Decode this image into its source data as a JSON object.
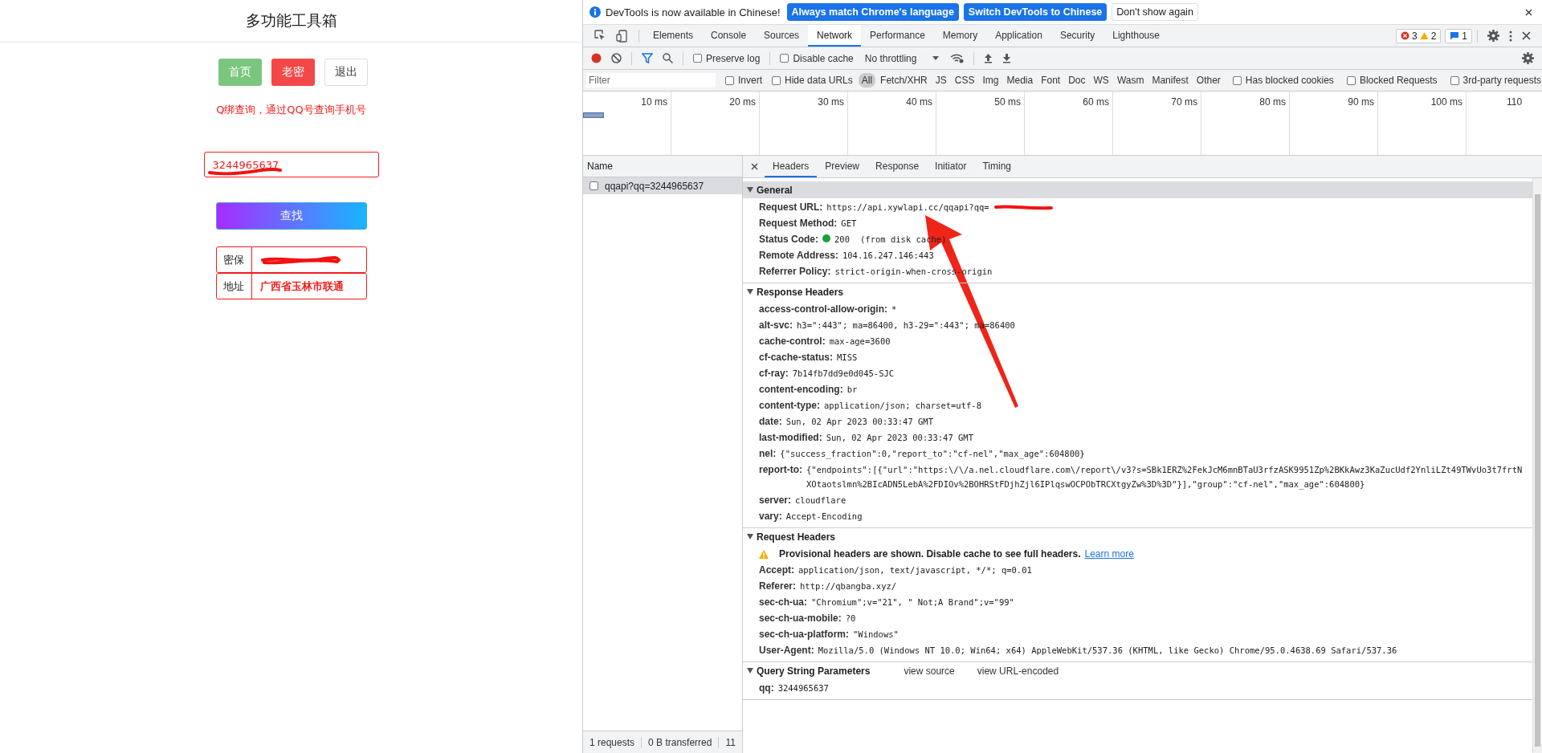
{
  "page": {
    "title": "多功能工具箱",
    "nav_buttons": [
      {
        "label": "首页",
        "kind": "success"
      },
      {
        "label": "老密",
        "kind": "danger"
      },
      {
        "label": "退出",
        "kind": "default"
      }
    ],
    "notice": "Q绑查询，通过QQ号查询手机号",
    "qq_input": {
      "value": "3244965637"
    },
    "search_button": "查找",
    "result_rows": [
      {
        "label": "密保",
        "redacted": true
      },
      {
        "label": "地址",
        "value": "广西省玉林市联通"
      }
    ]
  },
  "devtools": {
    "infobar": {
      "message": "DevTools is now available in Chinese!",
      "buttons": [
        {
          "label": "Always match Chrome's language",
          "kind": "primary"
        },
        {
          "label": "Switch DevTools to Chinese",
          "kind": "primary"
        },
        {
          "label": "Don't show again",
          "kind": "plain"
        }
      ]
    },
    "tabs": [
      {
        "label": "Elements",
        "selected": false
      },
      {
        "label": "Console",
        "selected": false
      },
      {
        "label": "Sources",
        "selected": false
      },
      {
        "label": "Network",
        "selected": true
      },
      {
        "label": "Performance",
        "selected": false
      },
      {
        "label": "Memory",
        "selected": false
      },
      {
        "label": "Application",
        "selected": false
      },
      {
        "label": "Security",
        "selected": false
      },
      {
        "label": "Lighthouse",
        "selected": false
      }
    ],
    "counters": {
      "errors": "3",
      "warnings": "2",
      "messages": "1"
    },
    "toolbar": {
      "preserve_log": {
        "label": "Preserve log",
        "checked": false
      },
      "disable_cache": {
        "label": "Disable cache",
        "checked": false
      },
      "throttling": "No throttling"
    },
    "filter": {
      "placeholder": "Filter",
      "checkboxes": [
        {
          "label": "Invert",
          "checked": false
        },
        {
          "label": "Hide data URLs",
          "checked": false
        }
      ],
      "types": [
        {
          "label": "All",
          "selected": true
        },
        {
          "label": "Fetch/XHR",
          "selected": false
        },
        {
          "label": "JS",
          "selected": false
        },
        {
          "label": "CSS",
          "selected": false
        },
        {
          "label": "Img",
          "selected": false
        },
        {
          "label": "Media",
          "selected": false
        },
        {
          "label": "Font",
          "selected": false
        },
        {
          "label": "Doc",
          "selected": false
        },
        {
          "label": "WS",
          "selected": false
        },
        {
          "label": "Wasm",
          "selected": false
        },
        {
          "label": "Manifest",
          "selected": false
        },
        {
          "label": "Other",
          "selected": false
        }
      ],
      "extra_checkboxes": [
        {
          "label": "Has blocked cookies",
          "checked": false
        },
        {
          "label": "Blocked Requests",
          "checked": false
        },
        {
          "label": "3rd-party requests",
          "checked": false
        }
      ]
    },
    "timeline_ticks": [
      "10 ms",
      "20 ms",
      "30 ms",
      "40 ms",
      "50 ms",
      "60 ms",
      "70 ms",
      "80 ms",
      "90 ms",
      "100 ms",
      "110"
    ],
    "name_column": "Name",
    "requests": [
      {
        "name": "qqapi?qq=3244965637",
        "selected": true
      }
    ],
    "detail_tabs": [
      {
        "label": "Headers",
        "selected": true
      },
      {
        "label": "Preview",
        "selected": false
      },
      {
        "label": "Response",
        "selected": false
      },
      {
        "label": "Initiator",
        "selected": false
      },
      {
        "label": "Timing",
        "selected": false
      }
    ],
    "sections": [
      {
        "title": "General",
        "expanded": true,
        "rows": [
          {
            "kind": "header",
            "key": "Request URL:",
            "value": "https://api.xywlapi.cc/qqapi?qq=",
            "redacted": true
          },
          {
            "kind": "header",
            "key": "Request Method:",
            "value": "GET"
          },
          {
            "kind": "status",
            "key": "Status Code:",
            "value": "200",
            "note": "(from disk cache)"
          },
          {
            "kind": "header",
            "key": "Remote Address:",
            "value": "104.16.247.146:443"
          },
          {
            "kind": "header",
            "key": "Referrer Policy:",
            "value": "strict-origin-when-cross-origin"
          }
        ]
      },
      {
        "title": "Response Headers",
        "expanded": true,
        "rows": [
          {
            "kind": "header",
            "key": "access-control-allow-origin:",
            "value": "*"
          },
          {
            "kind": "header",
            "key": "alt-svc:",
            "value": "h3=\":443\"; ma=86400, h3-29=\":443\"; ma=86400"
          },
          {
            "kind": "header",
            "key": "cache-control:",
            "value": "max-age=3600"
          },
          {
            "kind": "header",
            "key": "cf-cache-status:",
            "value": "MISS"
          },
          {
            "kind": "header",
            "key": "cf-ray:",
            "value": "7b14fb7dd9e0d045-SJC"
          },
          {
            "kind": "header",
            "key": "content-encoding:",
            "value": "br"
          },
          {
            "kind": "header",
            "key": "content-type:",
            "value": "application/json; charset=utf-8"
          },
          {
            "kind": "header",
            "key": "date:",
            "value": "Sun, 02 Apr 2023 00:33:47 GMT"
          },
          {
            "kind": "header",
            "key": "last-modified:",
            "value": "Sun, 02 Apr 2023 00:33:47 GMT"
          },
          {
            "kind": "header",
            "key": "nel:",
            "value": "{\"success_fraction\":0,\"report_to\":\"cf-nel\",\"max_age\":604800}"
          },
          {
            "kind": "header",
            "key": "report-to:",
            "value": "{\"endpoints\":[{\"url\":\"https:\\/\\/a.nel.cloudflare.com\\/report\\/v3?s=SBk1ERZ%2FekJcM6mnBTaU3rfzASK9951Zp%2BKkAwz3KaZucUdf2YnliLZt49TWvUo3t7frtNXOtaotslmn%2BIcADN5LebA%2FDIOv%2BOHRStFDjhZjl6IPlqswOCPObTRCXtgyZw%3D%3D\"}],\"group\":\"cf-nel\",\"max_age\":604800}"
          },
          {
            "kind": "header",
            "key": "server:",
            "value": "cloudflare"
          },
          {
            "kind": "header",
            "key": "vary:",
            "value": "Accept-Encoding"
          }
        ]
      },
      {
        "title": "Request Headers",
        "expanded": true,
        "rows": [
          {
            "kind": "warning",
            "text": "Provisional headers are shown. Disable cache to see full headers.",
            "link": "Learn more"
          },
          {
            "kind": "header",
            "key": "Accept:",
            "value": "application/json, text/javascript, */*; q=0.01"
          },
          {
            "kind": "header",
            "key": "Referer:",
            "value": "http://qbangba.xyz/"
          },
          {
            "kind": "header",
            "key": "sec-ch-ua:",
            "value": "\"Chromium\";v=\"21\", \" Not;A Brand\";v=\"99\""
          },
          {
            "kind": "header",
            "key": "sec-ch-ua-mobile:",
            "value": "?0"
          },
          {
            "kind": "header",
            "key": "sec-ch-ua-platform:",
            "value": "\"Windows\""
          },
          {
            "kind": "header",
            "key": "User-Agent:",
            "value": "Mozilla/5.0 (Windows NT 10.0; Win64; x64) AppleWebKit/537.36 (KHTML, like Gecko) Chrome/95.0.4638.69 Safari/537.36"
          }
        ]
      },
      {
        "title": "Query String Parameters",
        "expanded": true,
        "links": [
          "view source",
          "view URL-encoded"
        ],
        "rows": [
          {
            "kind": "header",
            "key": "qq:",
            "value": "3244965637"
          }
        ]
      }
    ],
    "status_bar": [
      "1 requests",
      "0 B transferred",
      "11"
    ]
  }
}
